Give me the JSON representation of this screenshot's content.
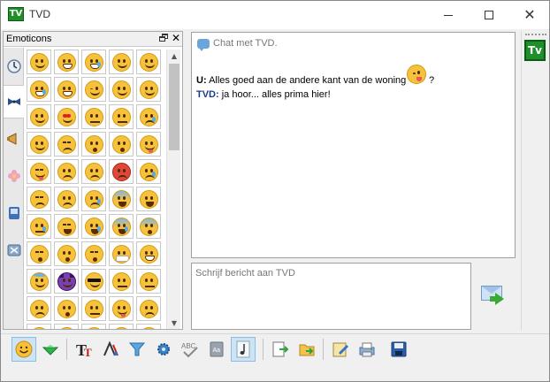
{
  "window": {
    "title": "TVD",
    "app_icon_text": "TV",
    "minimize": "minimize",
    "maximize": "maximize",
    "close": "close"
  },
  "emoticons": {
    "panel_title": "Emoticons",
    "categories": [
      "clock-icon",
      "bowtie-icon",
      "megaphone-icon",
      "flower-icon",
      "phone-icon",
      "puzzle-icon"
    ],
    "active_category": 1,
    "grid": [
      [
        "smile",
        "grin",
        "laugh-tears",
        "smile",
        "smile"
      ],
      [
        "sweat-smile",
        "grin",
        "wink",
        "smile",
        "smile"
      ],
      [
        "smile",
        "heart-eyes",
        "smirk",
        "unamused",
        "sweat"
      ],
      [
        "relieved",
        "confounded",
        "kiss-heart",
        "kissing",
        "tongue-wink"
      ],
      [
        "tongue-closed",
        "disappointed",
        "worried",
        "angry",
        "cry"
      ],
      [
        "persevere",
        "triumph",
        "disappointed-relieved",
        "fearful",
        "weary"
      ],
      [
        "sleepy",
        "tired",
        "sob",
        "cold-sweat",
        "scream"
      ],
      [
        "dizzy",
        "astonished",
        "dizzy-face",
        "mask",
        "grin"
      ],
      [
        "innocent",
        "imp",
        "sunglasses",
        "neutral",
        "expressionless"
      ],
      [
        "confused",
        "hushed",
        "smirk",
        "tongue",
        "frowning"
      ],
      [
        "anguished",
        "open-mouth",
        "grimace",
        "flushed",
        "sad"
      ]
    ]
  },
  "chat": {
    "header": "Chat met TVD.",
    "messages": [
      {
        "sender": "U:",
        "text": "Alles goed aan de andere kant van de woning",
        "trailing": "?"
      },
      {
        "sender": "TVD:",
        "text": "ja hoor... alles prima hier!"
      }
    ]
  },
  "input": {
    "placeholder": "Schrijf bericht aan TVD"
  },
  "contact": {
    "avatar_text": "Tv"
  },
  "toolbar": {
    "buttons": [
      "emoticon-icon",
      "wink-gesture-icon",
      "font-icon",
      "color-icon",
      "filter-icon",
      "settings-icon",
      "spellcheck-icon",
      "dictionary-icon",
      "sound-icon",
      "export-icon",
      "send-file-icon",
      "notes-icon",
      "print-icon",
      "save-icon"
    ]
  },
  "colors": {
    "accent_green": "#1f8f2a",
    "tvd_blue": "#1a3a8a",
    "smiley_yellow": "#f7c23b"
  }
}
